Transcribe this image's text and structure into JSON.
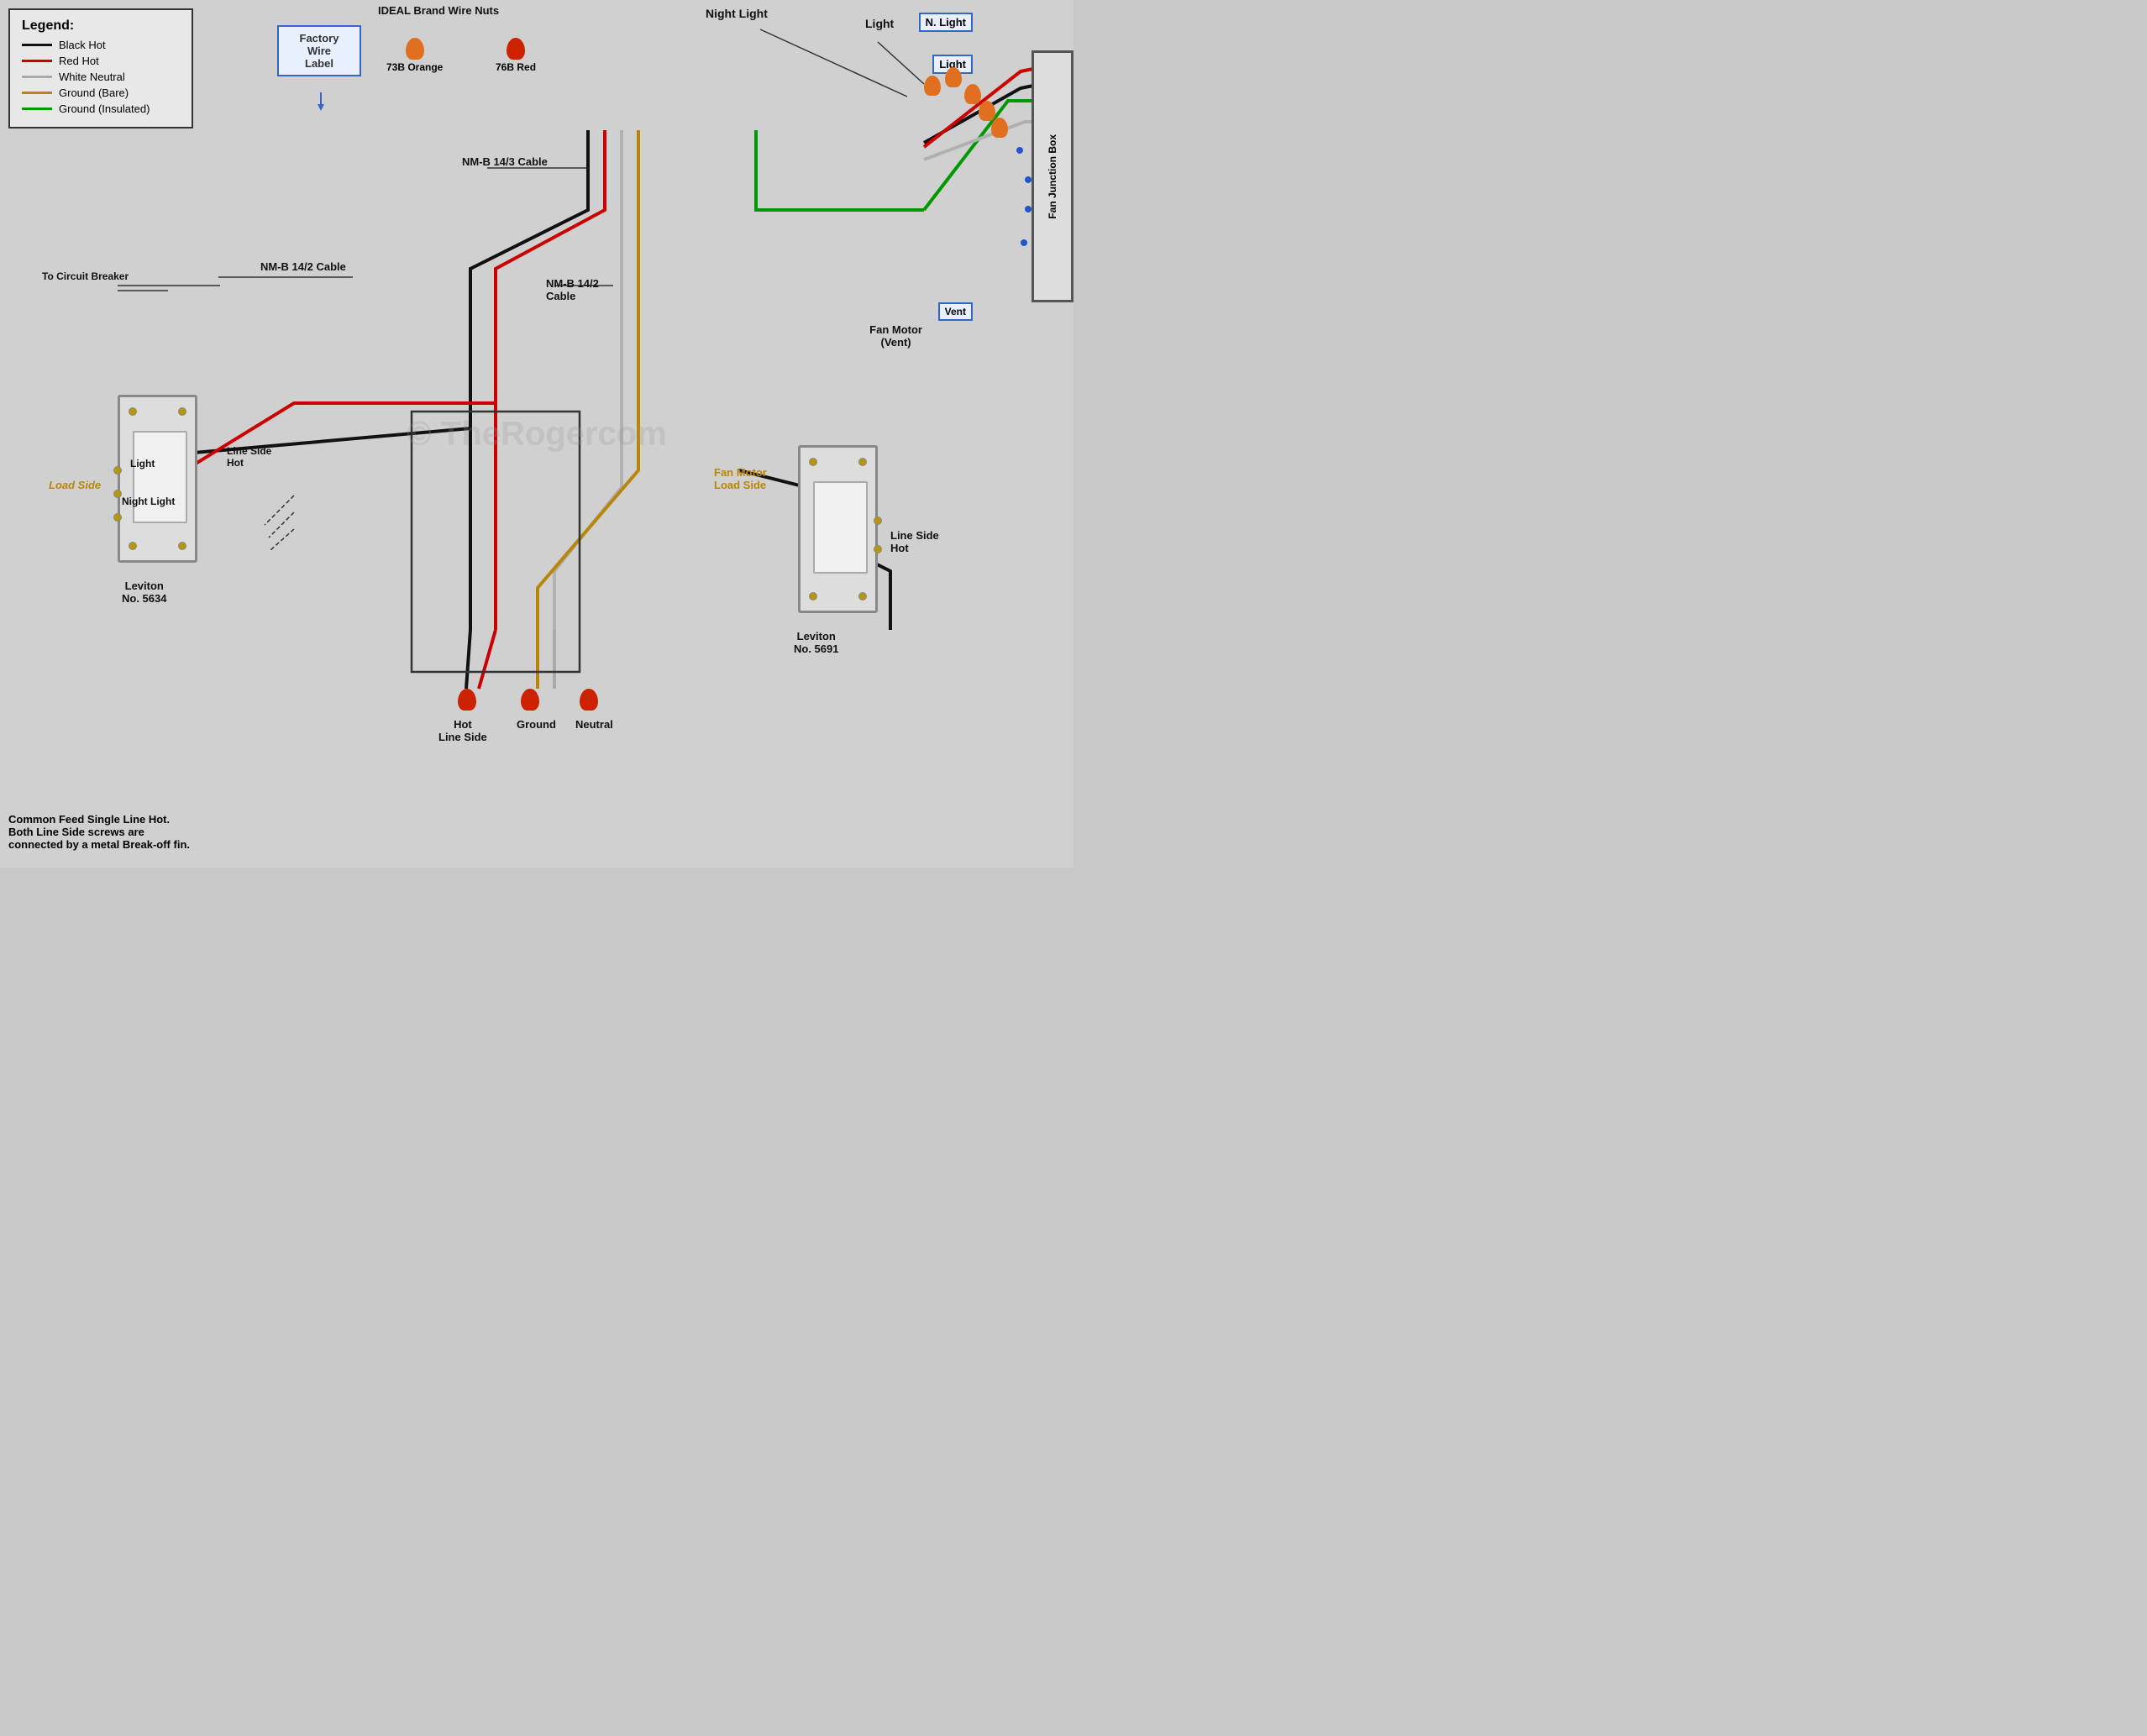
{
  "legend": {
    "title": "Legend:",
    "items": [
      {
        "id": "black-hot",
        "label": "Black Hot",
        "color": "#111111"
      },
      {
        "id": "red-hot",
        "label": "Red Hot",
        "color": "#cc0000"
      },
      {
        "id": "white-neutral",
        "label": "White Neutral",
        "color": "#cccccc"
      },
      {
        "id": "ground-bare",
        "label": "Ground (Bare)",
        "color": "#b8860b"
      },
      {
        "id": "ground-insulated",
        "label": "Ground (Insulated)",
        "color": "#009900"
      }
    ]
  },
  "factory_wire_label": "Factory\nWire\nLabel",
  "ideal_brand": "IDEAL Brand Wire Nuts",
  "nut_73b": "73B Orange",
  "nut_76b": "76B Red",
  "cable_labels": {
    "nmb_143": "NM-B 14/3 Cable",
    "nmb_142_left": "NM-B 14/2 Cable",
    "nmb_142_right": "NM-B 14/2\nCable"
  },
  "circuit_breaker": "To Circuit Breaker",
  "fan_motor_vent": "Fan Motor\n(Vent)",
  "fan_junction_box": "Fan Junction Box",
  "labels": {
    "night_light_top": "Night Light",
    "light_top": "Light",
    "n_light": "N. Light",
    "light2": "Light",
    "vent": "Vent",
    "light_switch_left": "Light",
    "night_light_switch_left": "Night Light",
    "load_side_left": "Load Side",
    "line_side_hot_left": "Line Side\nHot",
    "fan_motor_load_side": "Fan Motor\nLoad Side",
    "line_side_hot_right": "Line Side\nHot",
    "hot_line_side": "Hot\nLine Side",
    "ground_bottom": "Ground",
    "neutral_bottom": "Neutral",
    "leviton_left": "Leviton\nNo. 5634",
    "leviton_right": "Leviton\nNo. 5691",
    "common_feed": "Common Feed Single Line Hot.\nBoth Line Side screws are\nconnected by a metal Break-off fin."
  }
}
